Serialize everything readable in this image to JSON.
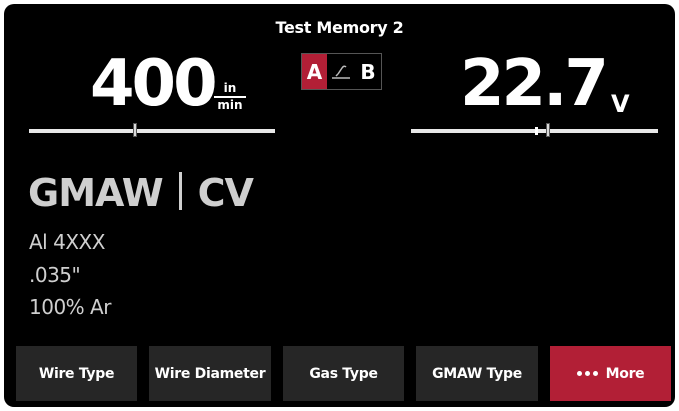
{
  "header": {
    "title": "Test Memory 2"
  },
  "wire_feed": {
    "value": "400",
    "unit_top": "in",
    "unit_bottom": "min"
  },
  "voltage": {
    "value": "22.7",
    "unit": "V"
  },
  "ab_toggle": {
    "a_label": "A",
    "b_label": "B",
    "selected": "A",
    "middle_icon": "torch-icon"
  },
  "process": {
    "mode": "GMAW",
    "type": "CV"
  },
  "specs": {
    "wire_type": "Al 4XXX",
    "wire_diameter": ".035\"",
    "gas_type": "100% Ar"
  },
  "buttons": {
    "wire_type": "Wire Type",
    "wire_diameter": "Wire Diameter",
    "gas_type": "Gas Type",
    "gmaw_type": "GMAW Type",
    "more": "More"
  },
  "colors": {
    "accent": "#b21f36",
    "background": "#000000",
    "button_bg": "#262626"
  }
}
